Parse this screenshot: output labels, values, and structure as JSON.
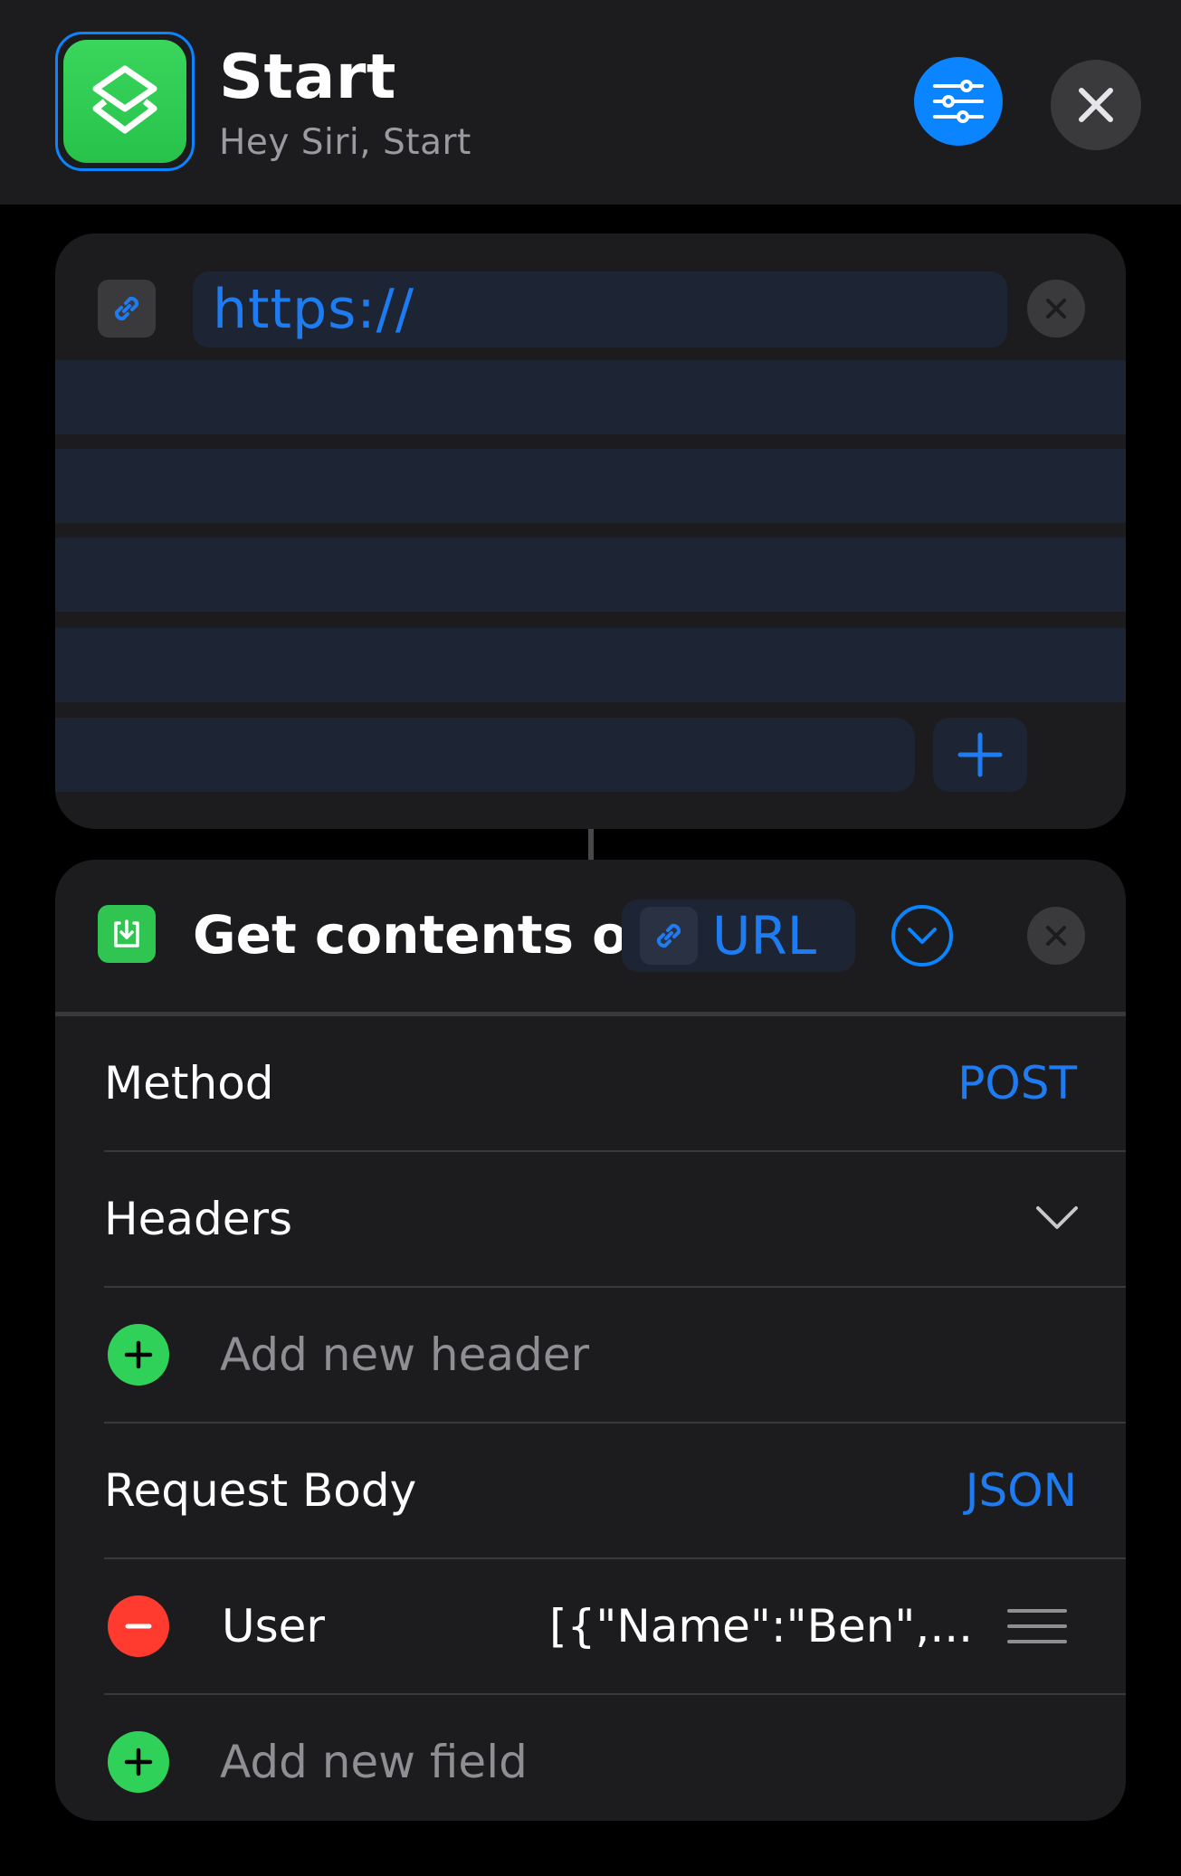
{
  "header": {
    "title": "Start",
    "subtitle": "Hey Siri, Start",
    "app_icon": "shortcuts-icon",
    "settings_icon": "sliders-icon",
    "close_icon": "close-icon",
    "accent": "#0a84ff"
  },
  "url_action": {
    "url_value": "https://",
    "link_icon": "link-icon",
    "add_icon": "plus-icon"
  },
  "get_contents": {
    "title": "Get contents of",
    "url_token": "URL",
    "method_label": "Method",
    "method_value": "POST",
    "headers_label": "Headers",
    "add_header_placeholder": "Add new header",
    "body_label": "Request Body",
    "body_type": "JSON",
    "fields": [
      {
        "key": "User",
        "value": "[{\"Name\":\"Ben\",..."
      }
    ],
    "add_field_placeholder": "Add new field",
    "colors": {
      "add": "#30d158",
      "remove": "#ff3b30",
      "link": "#1e7cf2"
    }
  }
}
